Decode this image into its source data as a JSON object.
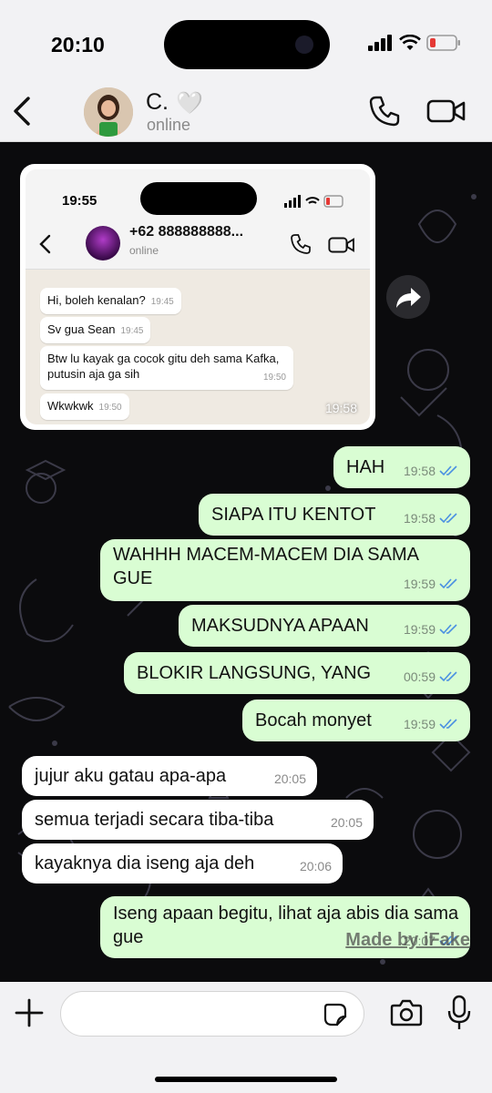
{
  "status": {
    "time": "20:10"
  },
  "header": {
    "contact_name": "C.",
    "contact_emoji": "🤍",
    "status": "online"
  },
  "embedded_screenshot": {
    "time": "19:55",
    "contact": "+62 888888888...",
    "status": "online",
    "messages": [
      {
        "text": "Hi, boleh kenalan?",
        "time": "19:45"
      },
      {
        "text": "Sv gua Sean",
        "time": "19:45"
      },
      {
        "text": "Btw lu kayak ga cocok gitu deh sama Kafka, putusin aja ga sih",
        "time": "19:50"
      },
      {
        "text": "Wkwkwk",
        "time": "19:50"
      }
    ],
    "sent_time": "19:58"
  },
  "messages": [
    {
      "text": "HAH",
      "time": "19:58",
      "dir": "out"
    },
    {
      "text": "SIAPA ITU KENTOT",
      "time": "19:58",
      "dir": "out"
    },
    {
      "text": "WAHHH MACEM-MACEM DIA SAMA GUE",
      "time": "19:59",
      "dir": "out"
    },
    {
      "text": "MAKSUDNYA APAAN",
      "time": "19:59",
      "dir": "out"
    },
    {
      "text": "BLOKIR LANGSUNG, YANG",
      "time": "00:59",
      "dir": "out"
    },
    {
      "text": "Bocah monyet",
      "time": "19:59",
      "dir": "out"
    },
    {
      "text": "jujur aku gatau apa-apa",
      "time": "20:05",
      "dir": "in"
    },
    {
      "text": "semua terjadi secara tiba-tiba",
      "time": "20:05",
      "dir": "in"
    },
    {
      "text": "kayaknya dia iseng aja deh",
      "time": "20:06",
      "dir": "in"
    },
    {
      "text": "Iseng apaan begitu, lihat aja abis dia sama gue",
      "time": "20:07",
      "dir": "out"
    }
  ],
  "watermark": "Made by iFake",
  "input": {
    "placeholder": ""
  },
  "colors": {
    "outgoing": "#d9fdd3",
    "incoming": "#ffffff",
    "read_tick": "#4a90e2",
    "chat_bg": "#0b0b0d"
  }
}
